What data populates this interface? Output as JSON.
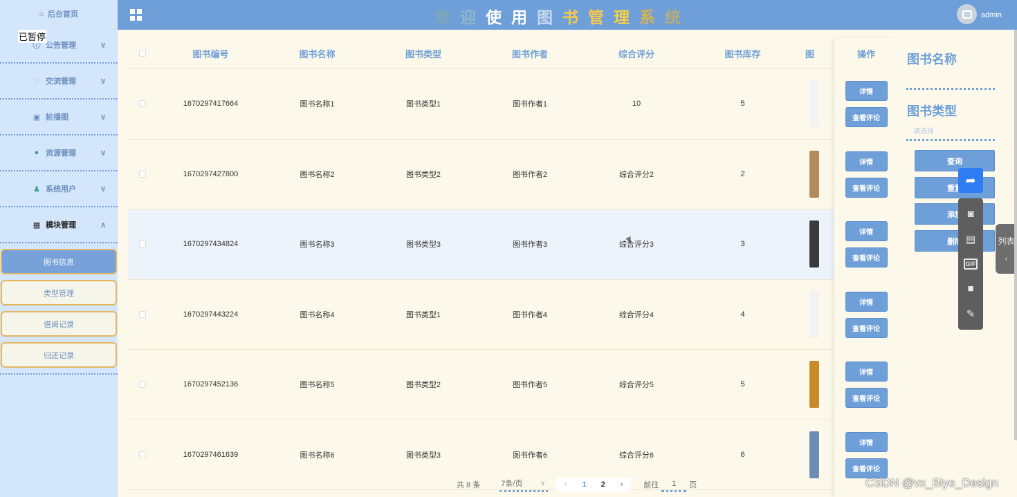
{
  "sidebar": {
    "home_label": "后台首页",
    "home_icon": "home-icon",
    "paused_label": "已暂停",
    "groups": [
      {
        "label": "公告管理",
        "icon": "info-circle-icon"
      },
      {
        "label": "交流管理",
        "icon": "chat-icon"
      },
      {
        "label": "轮播图",
        "icon": "image-icon"
      },
      {
        "label": "资源管理",
        "icon": "location-icon"
      },
      {
        "label": "系统用户",
        "icon": "user-icon"
      },
      {
        "label": "模块管理",
        "icon": "grid-icon"
      }
    ],
    "sub_items": [
      {
        "label": "图书信息",
        "selected": true
      },
      {
        "label": "类型管理",
        "selected": false
      },
      {
        "label": "借阅记录",
        "selected": false
      },
      {
        "label": "归还记录",
        "selected": false
      }
    ]
  },
  "header": {
    "title_chars": [
      "欢",
      "迎",
      "使",
      "用",
      "图",
      "书",
      "管",
      "理",
      "系",
      "统"
    ],
    "title_colors": [
      "#82a7b3",
      "#91b6cf",
      "#ffffff",
      "#ffffff",
      "#c8d8ef",
      "#f8c94a",
      "#f8c94a",
      "#f7d043",
      "#d9b14e",
      "#b8ad74"
    ],
    "user": "admin"
  },
  "table": {
    "columns": [
      "图书编号",
      "图书名称",
      "图书类型",
      "图书作者",
      "综合评分",
      "图书库存",
      "图"
    ],
    "op_header": "操作",
    "rows": [
      {
        "id": "1670297417664",
        "name": "图书名称1",
        "type": "图书类型1",
        "author": "图书作者1",
        "score": "10",
        "stock": "5",
        "thumb": "#f3f3f3"
      },
      {
        "id": "1670297427800",
        "name": "图书名称2",
        "type": "图书类型2",
        "author": "图书作者2",
        "score": "综合评分2",
        "stock": "2",
        "thumb": "#b58a5a"
      },
      {
        "id": "1670297434824",
        "name": "图书名称3",
        "type": "图书类型3",
        "author": "图书作者3",
        "score": "综合评分3",
        "stock": "3",
        "thumb": "#3b3b3b"
      },
      {
        "id": "1670297443224",
        "name": "图书名称4",
        "type": "图书类型1",
        "author": "图书作者4",
        "score": "综合评分4",
        "stock": "4",
        "thumb": "#f2f2f2"
      },
      {
        "id": "1670297452136",
        "name": "图书名称5",
        "type": "图书类型2",
        "author": "图书作者5",
        "score": "综合评分5",
        "stock": "5",
        "thumb": "#c98a2a"
      },
      {
        "id": "1670297461639",
        "name": "图书名称6",
        "type": "图书类型3",
        "author": "图书作者6",
        "score": "综合评分6",
        "stock": "6",
        "thumb": "#6d8bb5"
      }
    ],
    "op_detail": "详情",
    "op_comment": "查看评论"
  },
  "search": {
    "name_label": "图书名称",
    "type_label": "图书类型",
    "type_placeholder": "请选择",
    "buttons": [
      "查询",
      "重置",
      "添加",
      "删除"
    ]
  },
  "tools": {
    "side_tab_label": "列表",
    "icons": [
      "share-icon",
      "camera-icon",
      "gallery-icon",
      "gif-icon",
      "video-icon",
      "pen-icon"
    ]
  },
  "pagination": {
    "total": "共 8 条",
    "page_size": "7条/页",
    "pages": [
      "1",
      "2"
    ],
    "current_page": "1",
    "goto_label": "前往",
    "goto_value": "1",
    "page_suffix": "页"
  },
  "watermark": "CSDN @vx_Biye_Design",
  "colors": {
    "accent": "#6f9fd8",
    "background": "#fdf9ea",
    "sidebar": "#d4e6fb",
    "sub_border": "#e3b761"
  }
}
